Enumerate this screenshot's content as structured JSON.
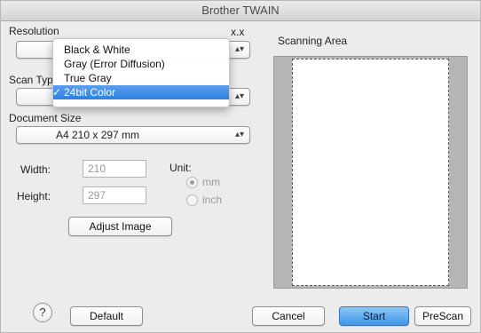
{
  "window": {
    "title": "Brother TWAIN"
  },
  "resolution": {
    "label": "Resolution",
    "value_fragment": "x.x"
  },
  "scan_type": {
    "label": "Scan Type"
  },
  "scan_type_menu": {
    "items": [
      {
        "label": "Black & White",
        "selected": false
      },
      {
        "label": "Gray (Error Diffusion)",
        "selected": false
      },
      {
        "label": "True Gray",
        "selected": false
      },
      {
        "label": "24bit Color",
        "selected": true
      }
    ],
    "check_glyph": "✓"
  },
  "document_size": {
    "label": "Document Size",
    "value": "A4  210 x 297 mm"
  },
  "dimensions": {
    "width_label": "Width:",
    "width_value": "210",
    "height_label": "Height:",
    "height_value": "297",
    "unit_label": "Unit:",
    "unit_options": [
      {
        "label": "mm",
        "selected": true
      },
      {
        "label": "inch",
        "selected": false
      }
    ]
  },
  "adjust_image_button": "Adjust Image",
  "scanning_area": {
    "label": "Scanning Area"
  },
  "footer": {
    "help_label": "?",
    "default_label": "Default",
    "cancel_label": "Cancel",
    "start_label": "Start",
    "prescan_label": "PreScan"
  }
}
